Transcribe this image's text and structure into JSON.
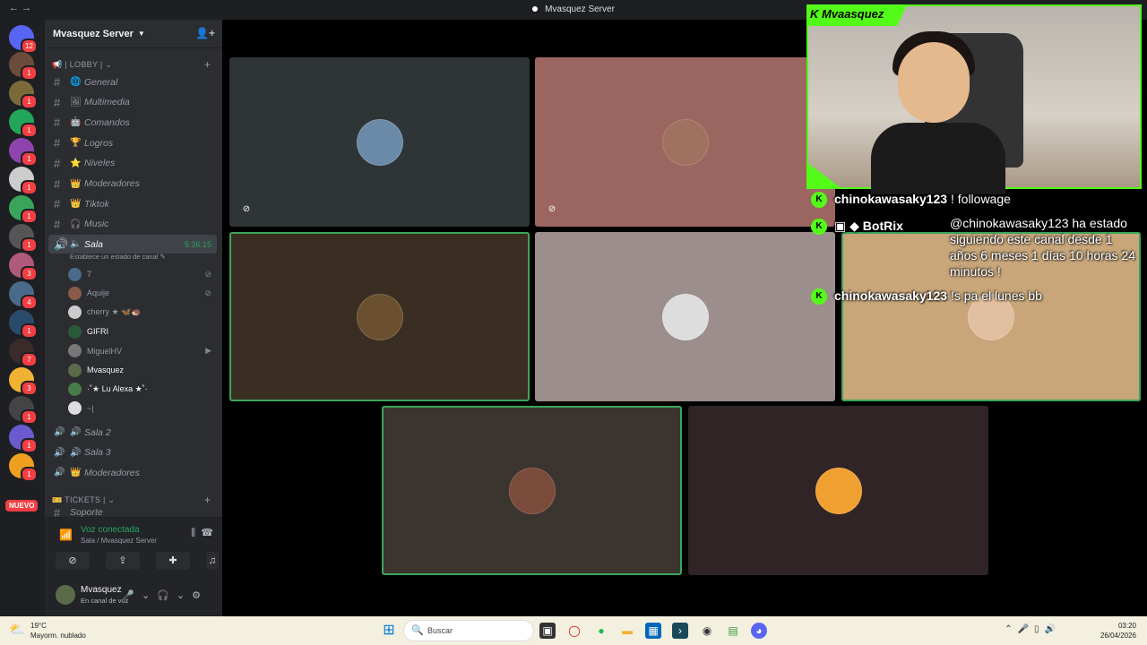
{
  "window": {
    "title": "Mvasquez Server"
  },
  "rail": {
    "servers": [
      {
        "badge": "12",
        "color": "#5865f2"
      },
      {
        "badge": "1",
        "color": "#6b4b3a"
      },
      {
        "badge": "1",
        "color": "#7a6a3a"
      },
      {
        "badge": "1",
        "color": "#23a55a"
      },
      {
        "badge": "1",
        "color": "#8e44ad"
      },
      {
        "badge": "1",
        "color": "#cccccc"
      },
      {
        "badge": "1",
        "color": "#3aa55a"
      },
      {
        "badge": "1",
        "color": "#555555"
      },
      {
        "badge": "3",
        "color": "#b05a7a"
      },
      {
        "badge": "4",
        "color": "#4a6a8a"
      },
      {
        "badge": "1",
        "color": "#2a4a6a"
      },
      {
        "badge": "7",
        "color": "#3a2a2a"
      },
      {
        "badge": "3",
        "color": "#f0b232"
      },
      {
        "badge": "1",
        "color": "#444444"
      },
      {
        "badge": "1",
        "color": "#6a5acd"
      },
      {
        "badge": "1",
        "color": "#f0a020"
      }
    ],
    "nuevo_label": "NUEVO"
  },
  "sidebar": {
    "server_name": "Mvasquez Server",
    "categories": {
      "lobby": "📢 | LOBBY |",
      "tickets": "🎫 TICKETS |"
    },
    "channels": [
      {
        "emoji": "🌐",
        "name": "General"
      },
      {
        "emoji": "🖼",
        "name": "Multimedia"
      },
      {
        "emoji": "🤖",
        "name": "Comandos"
      },
      {
        "emoji": "🏆",
        "name": "Logros"
      },
      {
        "emoji": "⭐",
        "name": "Niveles"
      },
      {
        "emoji": "👑",
        "name": "Moderadores"
      },
      {
        "emoji": "👑",
        "name": "Tiktok"
      },
      {
        "emoji": "🎧",
        "name": "Music"
      }
    ],
    "voice_active": {
      "name": "Sala",
      "timer": "5:36:15",
      "status": "Establece un estado de canal"
    },
    "members": [
      {
        "name": "7",
        "color": "#4a6a8a"
      },
      {
        "name": "Aquije",
        "color": "#8a5a4a"
      },
      {
        "name": "cherry ★ 🦋🦔",
        "color": "#cccccc"
      },
      {
        "name": "GIFRI",
        "color": "#2a5a3a"
      },
      {
        "name": "MiguelHV",
        "color": "#777777"
      },
      {
        "name": "Mvasquez",
        "color": "#5a6b4a"
      },
      {
        "name": "·˚★ Lu Alexa ★˚·",
        "color": "#4a7a4a"
      },
      {
        "name": "~|",
        "color": "#dddddd"
      }
    ],
    "voice_channels": [
      {
        "emoji": "🔊",
        "name": "Sala 2"
      },
      {
        "emoji": "🔊",
        "name": "Sala 3"
      },
      {
        "emoji": "👑",
        "name": "Moderadores"
      }
    ],
    "partial_channel": "Soporte",
    "voice_panel": {
      "title": "Voz conectada",
      "subtitle": "Sala / Mvasquez Server"
    },
    "user": {
      "name": "Mvasquez",
      "status": "En canal de voz"
    }
  },
  "stream": {
    "channel_name": "Mvaasquez",
    "chat": [
      {
        "user": "chinokawasaky123",
        "text": " ! followage"
      },
      {
        "user": "BotRix",
        "text": ""
      },
      {
        "user": "chinokawasaky123",
        "text": " !s pa el lunes bb"
      }
    ],
    "bot_reply": "@chinokawasaky123 ha estado siguiendo este canal desde 1 años 6 meses 1 días 10 horas 24 minutos !"
  },
  "tiles": [
    {
      "bg": "#2f3436",
      "avatar": "#6a8aa8",
      "speaking": false,
      "muted": true
    },
    {
      "bg": "#9c6660",
      "avatar": "#a07060",
      "speaking": false,
      "muted": true
    },
    {
      "bg": "#3a2e22",
      "avatar": "#6a5030",
      "speaking": true,
      "muted": false
    },
    {
      "bg": "#9c8e8c",
      "avatar": "#dddddd",
      "speaking": false,
      "muted": false
    },
    {
      "bg": "#c8a67a",
      "avatar": "#e0c0a0",
      "speaking": true,
      "muted": false
    },
    {
      "bg": "#3b3530",
      "avatar": "#7a4a3a",
      "speaking": true,
      "muted": false
    },
    {
      "bg": "#302426",
      "avatar": "#f0a030",
      "speaking": false,
      "muted": false
    }
  ],
  "taskbar": {
    "weather_temp": "19°C",
    "weather_desc": "Mayorm. nublado",
    "search_placeholder": "Buscar",
    "time": "03:20",
    "date": "26/04/2026"
  }
}
